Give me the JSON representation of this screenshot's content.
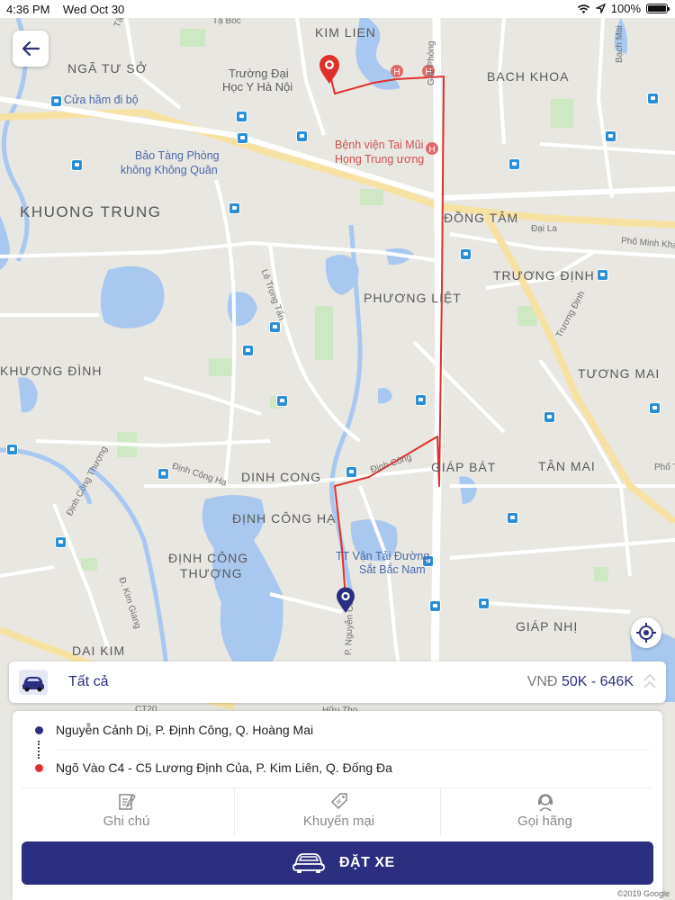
{
  "status_bar": {
    "time": "4:36 PM",
    "date": "Wed Oct 30",
    "battery": "100%"
  },
  "map": {
    "districts": [
      "KIM LIEN",
      "BACH KHOA",
      "NGÃ TƯ SỞ",
      "KHUONG TRUNG",
      "ĐỒNG TÂM",
      "PHƯƠNG LIỆT",
      "TRƯƠNG ĐỊNH",
      "KHƯƠNG ĐÌNH",
      "TƯƠNG MAI",
      "DINH CONG",
      "GIÁP BÁT",
      "TÂN MAI",
      "ĐỊNH CÔNG HẠ",
      "ĐỊNH CÔNG",
      "THƯỢNG",
      "DAI KIM",
      "GIÁP NHỊ"
    ],
    "pois": [
      "Trường Đại",
      "Học Y Hà Nội",
      "Cửa hầm đi bộ",
      "Bảo Tàng Phòng",
      "không Không Quân",
      "Bệnh viện Tai Mũi",
      "Họng Trung ương",
      "TT Vận Tải Đường",
      "Sắt Bắc Nam"
    ],
    "streets": [
      "Giải Phóng",
      "Bạch Mai",
      "Đại La",
      "Phố Minh Khai",
      "Lê Trọng Tấn",
      "Trương Định",
      "Định Công",
      "Định Công Hạ",
      "Định Công Thượng",
      "Đ. Kim Giang",
      "P. Nguyễn Cảnh",
      "Phố Tô",
      "Tạ Bốc",
      "Tây",
      "Hữu Thọ",
      "CT20"
    ],
    "copyright": "©2019 Google"
  },
  "car_bar": {
    "type_label": "Tất cả",
    "currency": "VNĐ",
    "price_range": "50K - 646K"
  },
  "route": {
    "pickup": "Nguyễn Cảnh Dị, P. Định Công, Q. Hoàng Mai",
    "dropoff": "Ngõ Vào C4 - C5 Lương Định Của, P. Kim Liên, Q. Đống Đa"
  },
  "actions": {
    "note": "Ghi chú",
    "promo": "Khuyến mại",
    "call": "Gọi hãng"
  },
  "book_button": {
    "label": "ĐẶT XE"
  },
  "colors": {
    "primary": "#2c2f80",
    "route": "#e0302c",
    "map_bg": "#e9e7e2",
    "water": "#a9c8ef",
    "park": "#cfe8c4",
    "road": "#ffffff",
    "highway": "#f6e3a4"
  },
  "icons": [
    "back-arrow-icon",
    "locate-icon",
    "car-icon",
    "chevron-up-icon",
    "note-icon",
    "promo-tag-icon",
    "call-center-icon",
    "sedan-icon",
    "wifi-icon",
    "location-arrow-icon",
    "battery-icon",
    "pickup-marker-icon",
    "dropoff-marker-icon",
    "bus-stop-icon",
    "hospital-icon"
  ]
}
